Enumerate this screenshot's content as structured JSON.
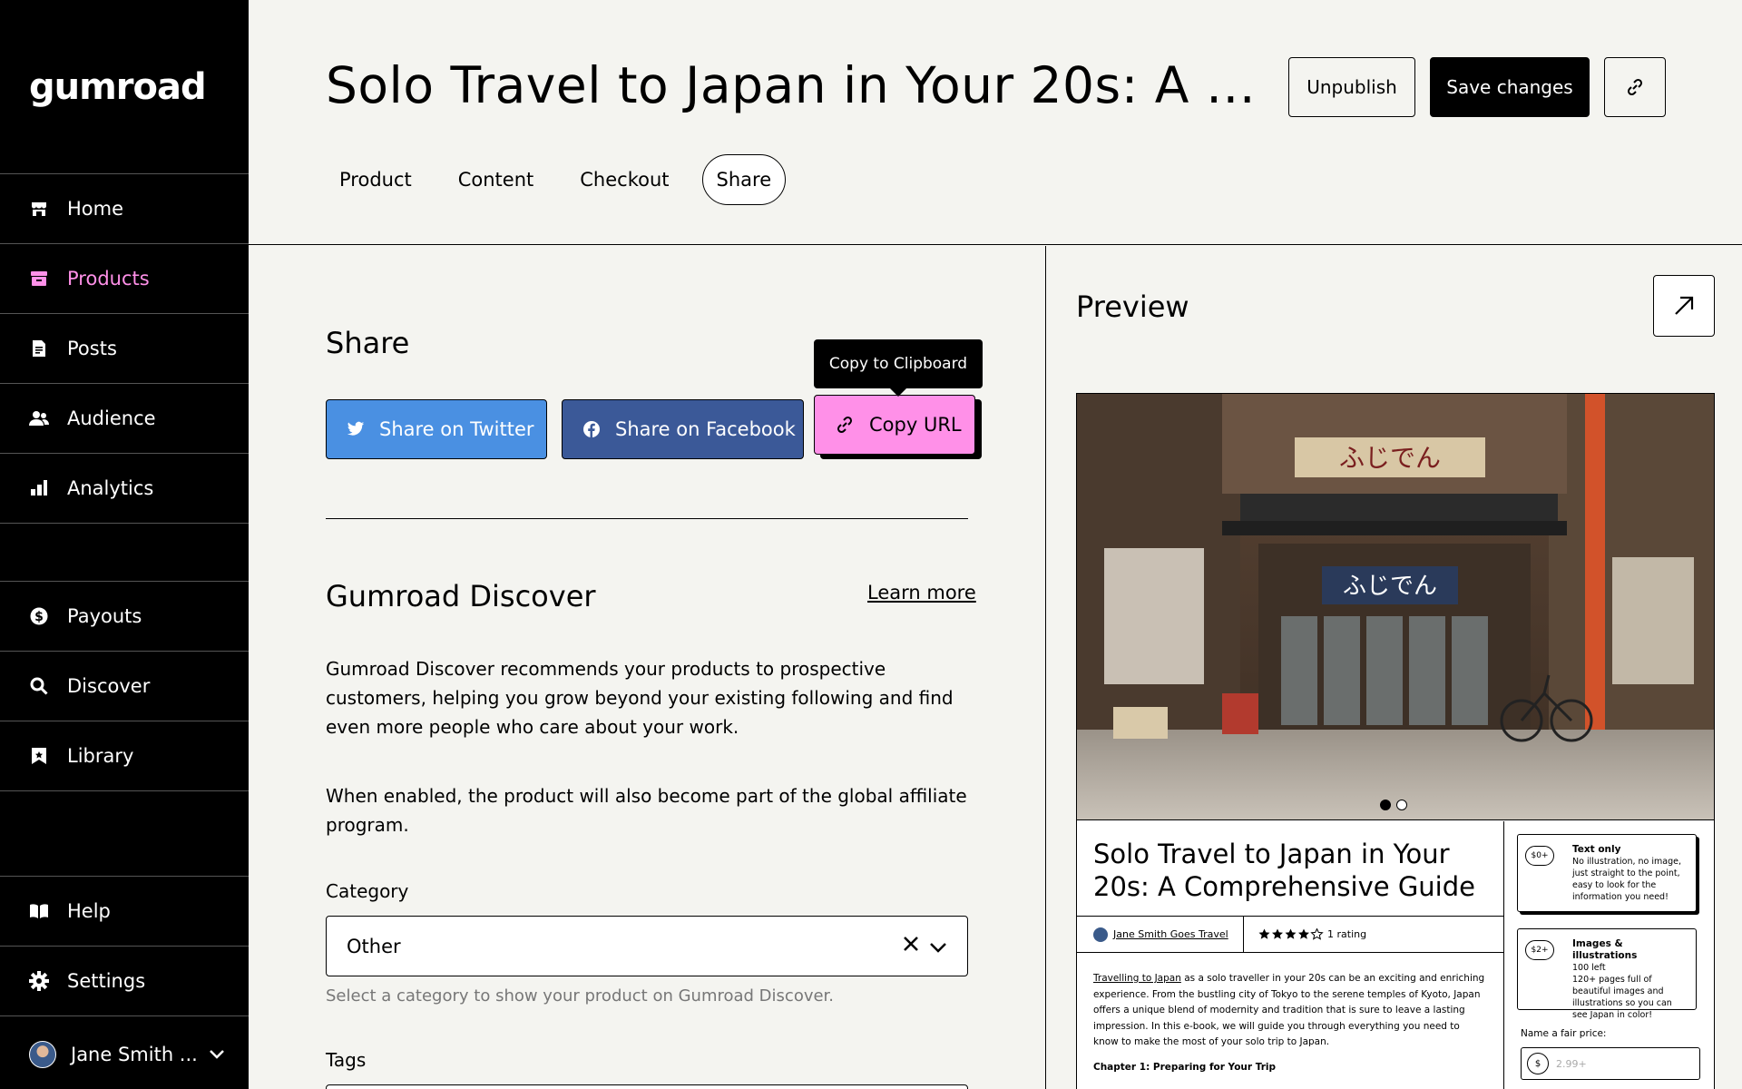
{
  "sidebar": {
    "logo": "gumroad",
    "items": [
      {
        "label": "Home",
        "icon": "store-icon"
      },
      {
        "label": "Products",
        "icon": "archive-icon"
      },
      {
        "label": "Posts",
        "icon": "document-icon"
      },
      {
        "label": "Audience",
        "icon": "people-icon"
      },
      {
        "label": "Analytics",
        "icon": "bar-chart-icon"
      },
      {
        "label": "Payouts",
        "icon": "dollar-circle-icon"
      },
      {
        "label": "Discover",
        "icon": "search-icon"
      },
      {
        "label": "Library",
        "icon": "bookmark-icon"
      },
      {
        "label": "Help",
        "icon": "book-icon"
      },
      {
        "label": "Settings",
        "icon": "gear-icon"
      }
    ],
    "active": "Products",
    "user_name": "Jane Smith ..."
  },
  "header": {
    "title": "Solo Travel to Japan in Your 20s: A Compr...",
    "unpublish_label": "Unpublish",
    "save_label": "Save changes",
    "tabs": [
      "Product",
      "Content",
      "Checkout",
      "Share"
    ],
    "active_tab": "Share"
  },
  "share": {
    "title": "Share",
    "twitter_label": "Share on Twitter",
    "facebook_label": "Share on Facebook",
    "copy_label": "Copy URL",
    "tooltip": "Copy to Clipboard"
  },
  "discover": {
    "title": "Gumroad Discover",
    "learn_more": "Learn more",
    "para1": "Gumroad Discover recommends your products to prospective customers, helping you grow beyond your existing following and find even more people who care about your work.",
    "para2": "When enabled, the product will also become part of the global affiliate program.",
    "category_label": "Category",
    "category_value": "Other",
    "category_hint": "Select a category to show your product on Gumroad Discover.",
    "tags_label": "Tags"
  },
  "preview": {
    "title": "Preview",
    "product_title": "Solo Travel to Japan in Your 20s: A Comprehensive Guide",
    "author": "Jane Smith Goes Travel",
    "rating_text": "1 rating",
    "rating_stars": 4,
    "desc_link": "Travelling to Japan",
    "desc_rest": " as a solo traveller in your 20s can be an exciting and enriching experience. From the bustling city of Tokyo to the serene temples of Kyoto, Japan offers a unique blend of modernity and tradition that is sure to leave a lasting impression. In this e-book, we will guide you through everything you need to know to make the most of your solo trip to Japan.",
    "chapter": "Chapter 1: Preparing for Your Trip",
    "tiers": [
      {
        "price": "$0+",
        "name": "Text only",
        "remaining": "",
        "desc": "No illustration, no image, just straight to the point, easy to look for the information you need!"
      },
      {
        "price": "$2+",
        "name": "Images & illustrations",
        "remaining": "100 left",
        "desc": "120+ pages full of beautiful images and illustrations so you can see Japan in color!"
      }
    ],
    "fair_price_label": "Name a fair price:",
    "currency": "$",
    "price_placeholder": "2.99+",
    "storefront_sign": "ふじでん"
  },
  "colors": {
    "accent_pink": "#ff90e8",
    "twitter": "#4a90e2",
    "facebook": "#3b5998",
    "sidebar_bg": "#000000",
    "page_bg": "#f4f4f0"
  }
}
